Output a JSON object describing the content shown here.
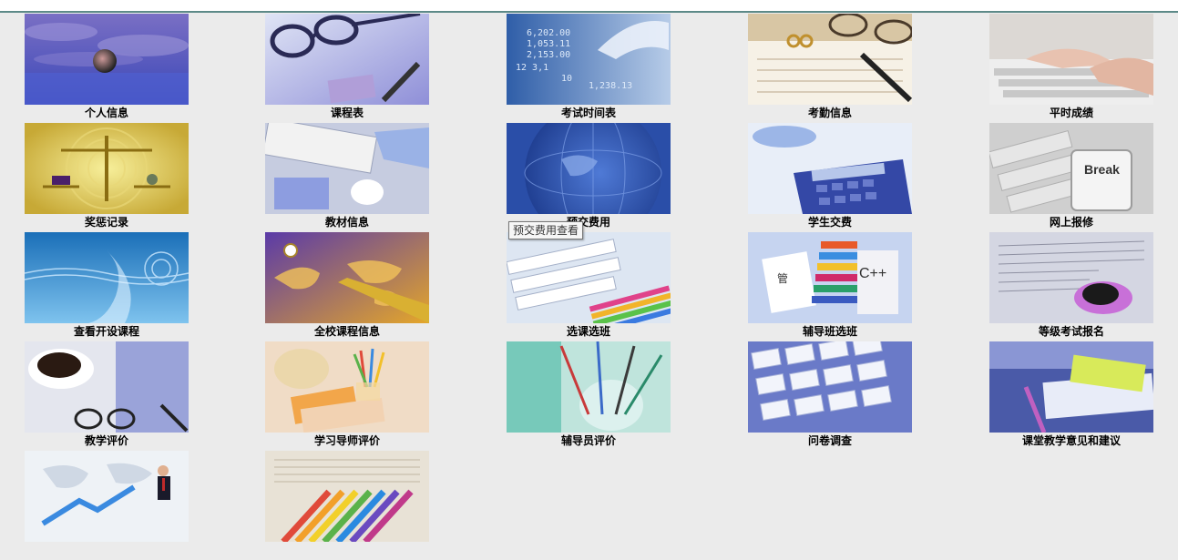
{
  "menu": {
    "tiles": [
      {
        "label": "个人信息",
        "icon": "globe-over-clouds-image"
      },
      {
        "label": "课程表",
        "icon": "glasses-and-pen-image"
      },
      {
        "label": "考试时间表",
        "icon": "numbers-and-hand-image"
      },
      {
        "label": "考勤信息",
        "icon": "notebook-and-glasses-image"
      },
      {
        "label": "平时成绩",
        "icon": "typing-hands-image"
      },
      {
        "label": "奖惩记录",
        "icon": "scales-image"
      },
      {
        "label": "教材信息",
        "icon": "keyboard-and-mouse-image"
      },
      {
        "label": "预交费用",
        "icon": "globe-closeup-image"
      },
      {
        "label": "学生交费",
        "icon": "calculator-image"
      },
      {
        "label": "网上报修",
        "icon": "break-key-image"
      },
      {
        "label": "查看开设课程",
        "icon": "blue-wave-image"
      },
      {
        "label": "全校课程信息",
        "icon": "world-map-pen-image"
      },
      {
        "label": "选课选班",
        "icon": "keyboard-and-books-image"
      },
      {
        "label": "辅导班选班",
        "icon": "books-cpp-image"
      },
      {
        "label": "等级考试报名",
        "icon": "newspaper-and-coffee-image"
      },
      {
        "label": "教学评价",
        "icon": "coffee-and-glasses-image"
      },
      {
        "label": "学习导师评价",
        "icon": "pencils-in-cup-image"
      },
      {
        "label": "辅导员评价",
        "icon": "brushes-in-glass-image"
      },
      {
        "label": "问卷调查",
        "icon": "keyboard-closeup-image"
      },
      {
        "label": "课堂教学意见和建议",
        "icon": "keyboard-and-papers-image"
      },
      {
        "label": "",
        "icon": "businessman-map-image"
      },
      {
        "label": "",
        "icon": "colored-pencils-book-image"
      }
    ]
  },
  "tooltip": {
    "text": "预交费用查看"
  },
  "colors": {
    "background": "#ebebeb",
    "top_rule": "#5d8a88"
  }
}
